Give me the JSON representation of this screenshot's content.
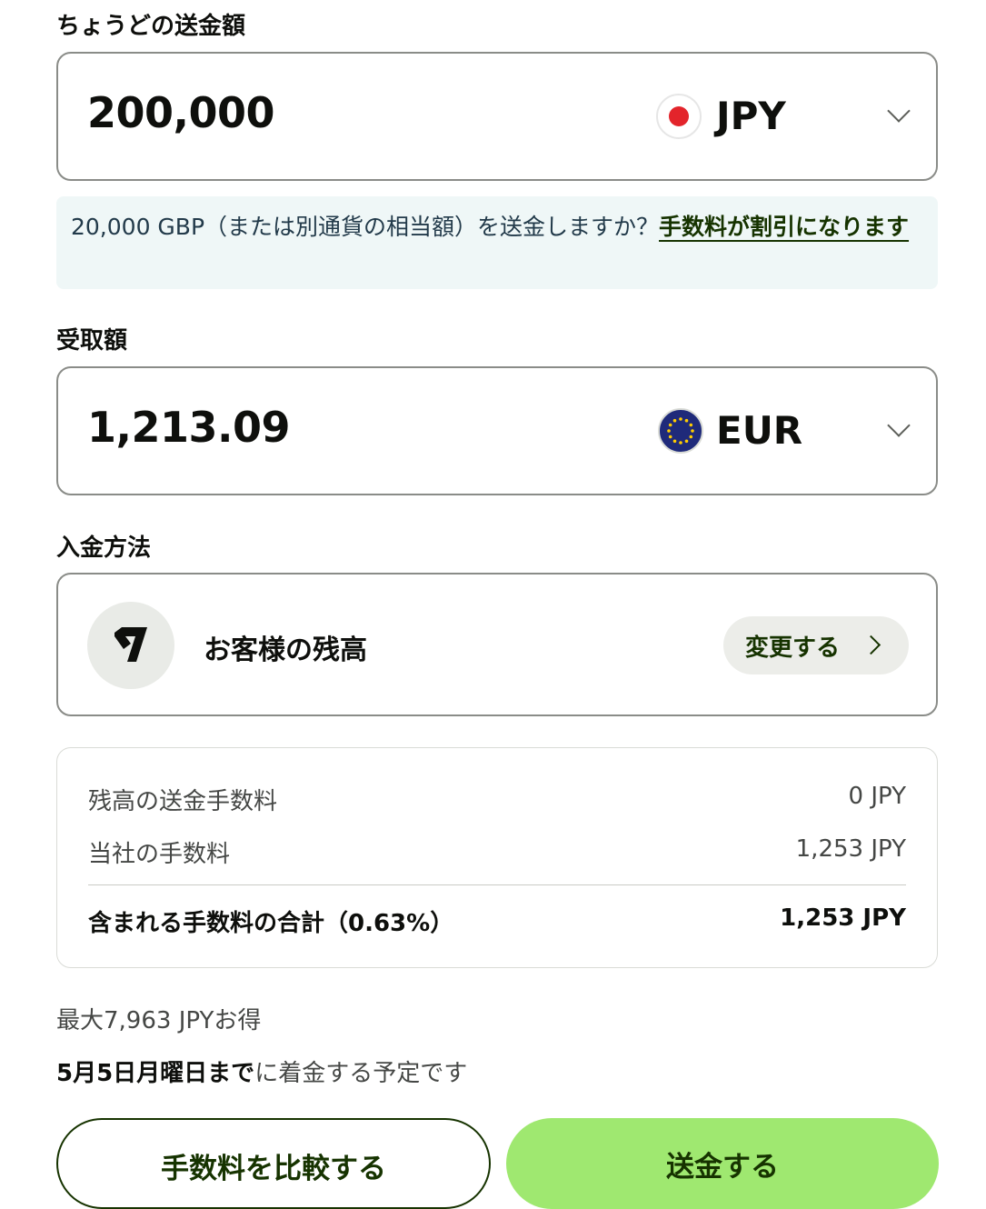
{
  "send": {
    "label": "ちょうどの送金額",
    "amount": "200,000",
    "currency": "JPY",
    "flag_icon": "japan-flag-icon"
  },
  "notice": {
    "text": "20,000 GBP（または別通貨の相当額）を送金しますか？",
    "link": "手数料が割引になります"
  },
  "receive": {
    "label": "受取額",
    "amount": "1,213.09",
    "currency": "EUR",
    "flag_icon": "eu-flag-icon"
  },
  "payment_method": {
    "label": "入金方法",
    "name": "お客様の残高",
    "change_label": "変更する"
  },
  "fees": {
    "rows": [
      {
        "label": "残高の送金手数料",
        "value": "0 JPY"
      },
      {
        "label": "当社の手数料",
        "value": "1,253 JPY"
      }
    ],
    "total_label": "含まれる手数料の合計（0.63%）",
    "total_value": "1,253 JPY"
  },
  "savings": "最大7,963 JPYお得",
  "arrival": {
    "date": "5月5日月曜日まで",
    "suffix": "に着金する予定です"
  },
  "buttons": {
    "compare": "手数料を比較する",
    "send": "送金する"
  },
  "colors": {
    "primary": "#9fe870",
    "primary_text": "#163300",
    "notice_bg": "#eff7f7",
    "jp_red": "#e3242b",
    "eu_blue": "#1f2a7a",
    "eu_star": "#ffcc00"
  }
}
